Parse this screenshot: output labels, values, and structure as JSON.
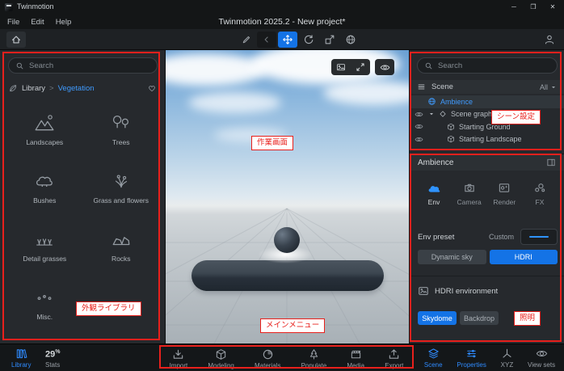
{
  "titlebar": {
    "app_name": "Twinmotion",
    "menus": [
      "File",
      "Edit",
      "Help"
    ],
    "window_title": "Twinmotion 2025.2 - New project*",
    "window_controls": {
      "minimize": "─",
      "maximize": "❒",
      "close": "✕"
    }
  },
  "library_panel": {
    "search_placeholder": "Search",
    "breadcrumb": {
      "root": "Library",
      "separator": ">",
      "current": "Vegetation"
    },
    "categories": [
      {
        "label": "Landscapes"
      },
      {
        "label": "Trees"
      },
      {
        "label": "Bushes"
      },
      {
        "label": "Grass and flowers"
      },
      {
        "label": "Detail grasses"
      },
      {
        "label": "Rocks"
      },
      {
        "label": "Misc."
      }
    ]
  },
  "scene_panel": {
    "search_placeholder": "Search",
    "header_label": "Scene",
    "filter_label": "All",
    "tree": [
      {
        "label": "Ambience"
      },
      {
        "label": "Scene graph"
      },
      {
        "label": "Starting Ground"
      },
      {
        "label": "Starting Landscape"
      }
    ]
  },
  "properties_panel": {
    "title": "Ambience",
    "tabs": [
      {
        "label": "Env"
      },
      {
        "label": "Camera"
      },
      {
        "label": "Render"
      },
      {
        "label": "FX"
      }
    ],
    "env_preset": {
      "label": "Env preset",
      "value": "Custom"
    },
    "sky_mode_buttons": [
      {
        "label": "Dynamic sky"
      },
      {
        "label": "HDRI"
      }
    ],
    "hdri_section_label": "HDRI environment",
    "hdri_buttons": [
      {
        "label": "Skydome"
      },
      {
        "label": "Backdrop"
      }
    ]
  },
  "bottom_bar": {
    "library_tab_label": "Library",
    "stats": {
      "value": "29",
      "unit": "%",
      "label": "Stats"
    },
    "center_menu": [
      {
        "label": "Import"
      },
      {
        "label": "Modeling"
      },
      {
        "label": "Materials"
      },
      {
        "label": "Populate"
      },
      {
        "label": "Media"
      },
      {
        "label": "Export"
      }
    ],
    "right_menu": [
      {
        "label": "Scene"
      },
      {
        "label": "Properties"
      },
      {
        "label": "XYZ"
      },
      {
        "label": "View sets"
      }
    ]
  },
  "annotations": {
    "color": "#e8201c",
    "labels": {
      "workspace": "作業画面",
      "scene_settings": "シーン設定",
      "library": "外観ライブラリ",
      "main_menu": "メインメニュー",
      "lighting": "照明"
    }
  },
  "colors": {
    "accent_blue": "#1473e6",
    "link_blue": "#3f9bff",
    "annotation_red": "#e8201c"
  }
}
